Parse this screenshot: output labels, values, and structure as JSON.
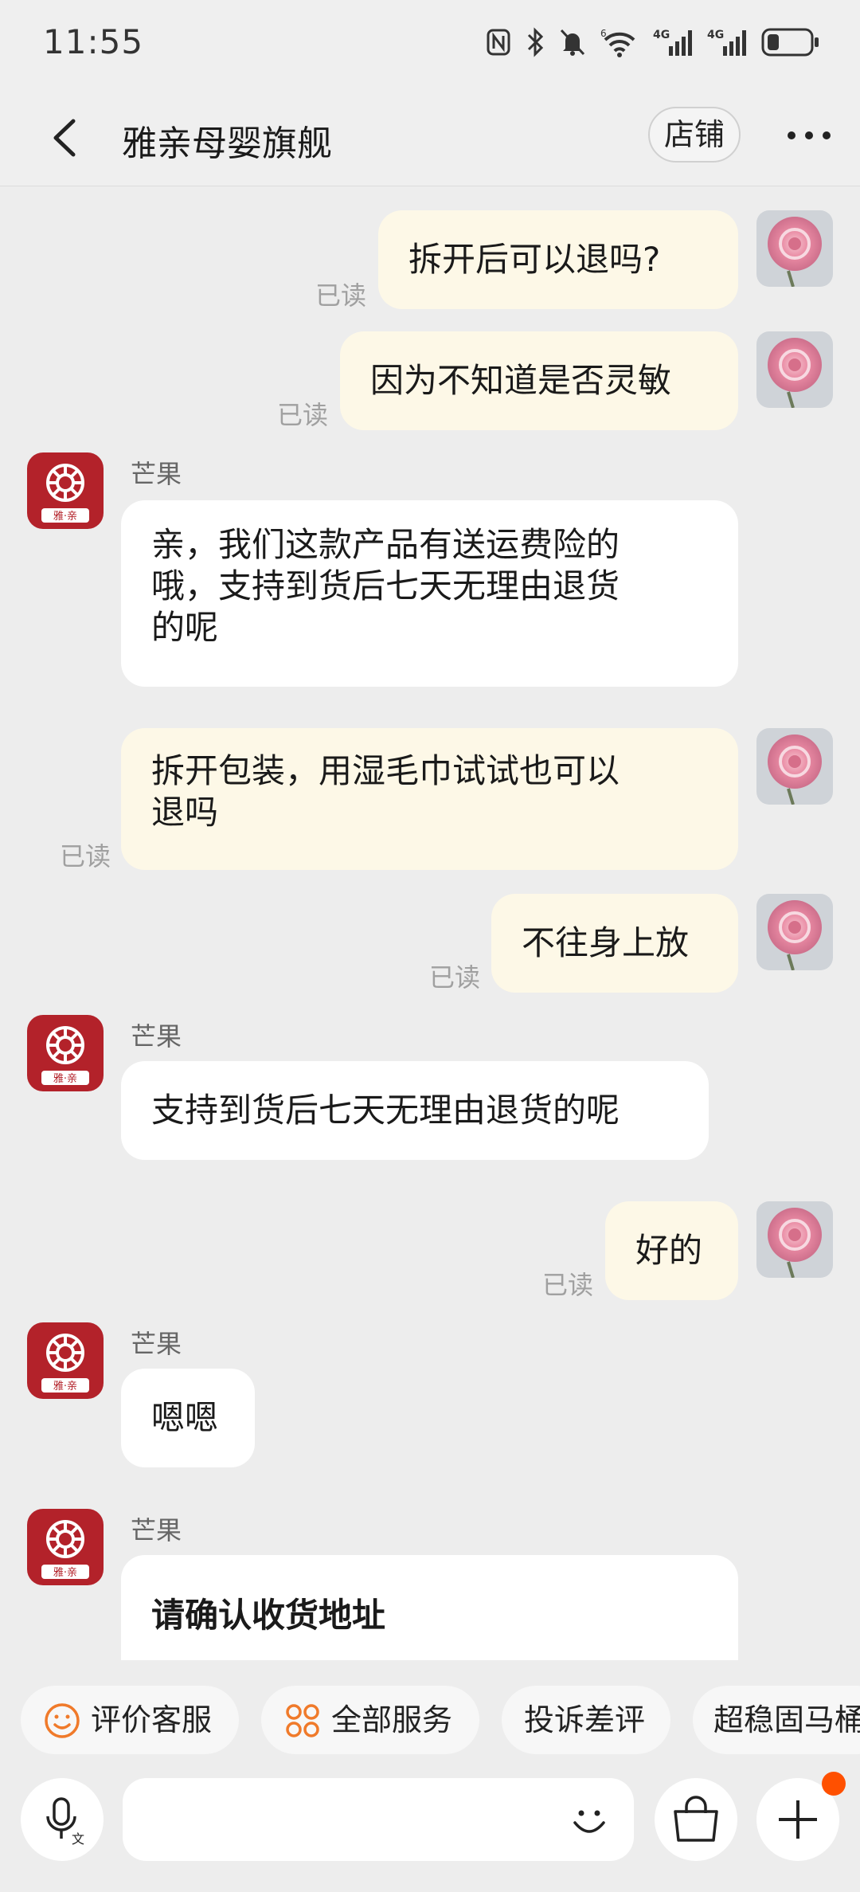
{
  "status_bar": {
    "time": "11:55"
  },
  "header": {
    "title": "雅亲母婴旗舰",
    "shop_button": "店铺"
  },
  "messages": [
    {
      "side": "me",
      "text": "拆开后可以退吗?",
      "status": "已读"
    },
    {
      "side": "me",
      "text": "因为不知道是否灵敏",
      "status": "已读"
    },
    {
      "side": "them",
      "sender": "芒果",
      "lines": [
        "亲，我们这款产品有送运费险的",
        "哦，支持到货后七天无理由退货",
        "的呢"
      ]
    },
    {
      "side": "me",
      "lines": [
        "拆开包装，用湿毛巾试试也可以",
        "退吗"
      ],
      "status": "已读"
    },
    {
      "side": "me",
      "text": "不往身上放",
      "status": "已读"
    },
    {
      "side": "them",
      "sender": "芒果",
      "text": "支持到货后七天无理由退货的呢"
    },
    {
      "side": "me",
      "text": "好的",
      "status": "已读"
    },
    {
      "side": "them",
      "sender": "芒果",
      "text": "嗯嗯"
    },
    {
      "side": "them",
      "sender": "芒果",
      "card_title": "请确认收货地址"
    }
  ],
  "shop_avatar_text": "雅·亲",
  "quick_actions": [
    "评价客服",
    "全部服务",
    "投诉差评",
    "超稳固马桶"
  ],
  "colors": {
    "my_bubble": "#fdf8e7",
    "their_bubble": "#ffffff",
    "shop_logo": "#b3222a",
    "accent": "#ff5000"
  },
  "icons": [
    "voice-input-icon",
    "emoji-icon",
    "shopping-bag-icon",
    "plus-icon",
    "smile-icon",
    "grid-services-icon"
  ]
}
